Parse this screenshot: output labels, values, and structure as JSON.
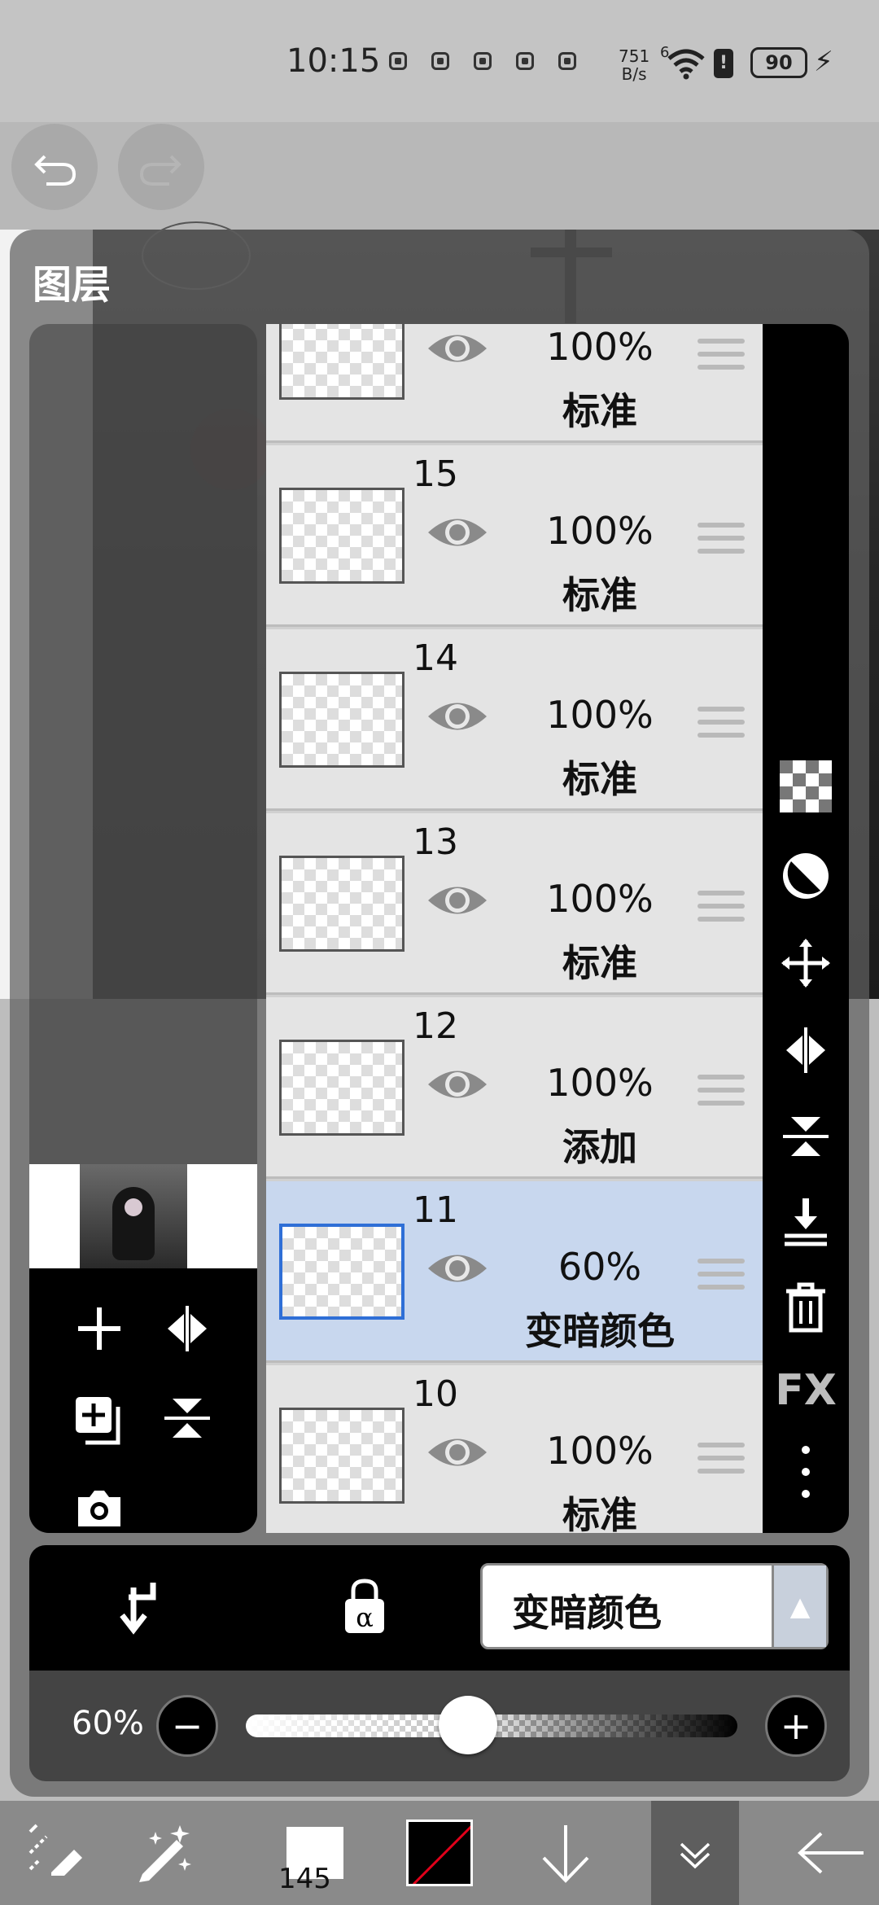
{
  "status_bar": {
    "time": "10:15",
    "network_speed_top": "751",
    "network_speed_unit": "B/s",
    "wifi_label": "6",
    "battery": "90"
  },
  "panel": {
    "title": "图层"
  },
  "layers": [
    {
      "number": "",
      "opacity": "100%",
      "mode": "标准",
      "selected": false
    },
    {
      "number": "15",
      "opacity": "100%",
      "mode": "标准",
      "selected": false
    },
    {
      "number": "14",
      "opacity": "100%",
      "mode": "标准",
      "selected": false
    },
    {
      "number": "13",
      "opacity": "100%",
      "mode": "标准",
      "selected": false
    },
    {
      "number": "12",
      "opacity": "100%",
      "mode": "添加",
      "selected": false
    },
    {
      "number": "11",
      "opacity": "60%",
      "mode": "变暗颜色",
      "selected": true
    },
    {
      "number": "10",
      "opacity": "100%",
      "mode": "标准",
      "selected": false
    }
  ],
  "right_toolbar": {
    "fx_label": "FX"
  },
  "blend": {
    "selected_mode": "变暗颜色"
  },
  "opacity_slider": {
    "value_label": "60%",
    "value": 0.6
  },
  "bottom_bar": {
    "brush_size": "145"
  },
  "colors": {
    "selected_layer": "#c8d7ee",
    "selection_border": "#2f6fd6",
    "primary_color": "#000000"
  }
}
